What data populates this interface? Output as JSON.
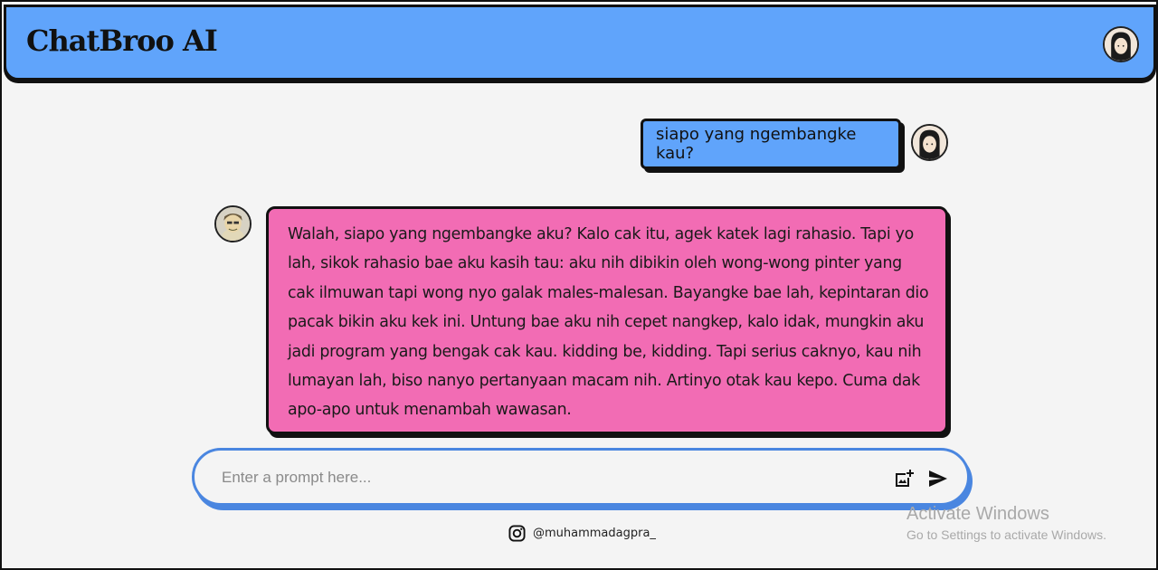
{
  "header": {
    "title": "ChatBroo AI",
    "avatar_icon": "user-avatar-icon"
  },
  "chat": {
    "user_message": "siapo yang ngembangke kau?",
    "bot_message": "Walah, siapo yang ngembangke aku? Kalo cak itu, agek katek lagi rahasio. Tapi yo lah, sikok rahasio bae aku kasih tau: aku nih dibikin oleh wong-wong pinter yang cak ilmuwan tapi wong nyo galak males-malesan. Bayangke bae lah, kepintaran dio pacak bikin aku kek ini. Untung bae aku nih cepet nangkep, kalo idak, mungkin aku jadi program yang bengak cak kau. kidding be, kidding. Tapi serius caknyo, kau nih lumayan lah, biso nanyo pertanyaan macam nih. Artinyo otak kau kepo. Cuma dak apo-apo untuk menambah wawasan.",
    "user_avatar_icon": "user-avatar-icon",
    "bot_avatar_icon": "bot-avatar-icon"
  },
  "prompt": {
    "placeholder": "Enter a prompt here...",
    "value": "",
    "image_icon": "add-photo-icon",
    "send_icon": "send-icon"
  },
  "footer": {
    "instagram_icon": "instagram-icon",
    "handle": "@muhammadagpra_"
  },
  "watermark": {
    "title": "Activate Windows",
    "subtitle": "Go to Settings to activate Windows."
  },
  "colors": {
    "header_bg": "#60a4fb",
    "user_bubble_bg": "#60a4fb",
    "bot_bubble_bg": "#f26cb4",
    "prompt_border": "#4a86e0",
    "page_bg": "#f4f4f4"
  }
}
